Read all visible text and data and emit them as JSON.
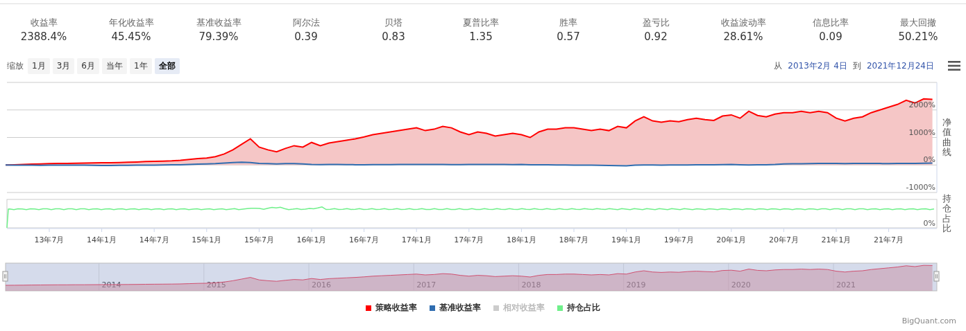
{
  "stats": [
    {
      "label": "收益率",
      "value": "2388.4%"
    },
    {
      "label": "年化收益率",
      "value": "45.45%"
    },
    {
      "label": "基准收益率",
      "value": "79.39%"
    },
    {
      "label": "阿尔法",
      "value": "0.39"
    },
    {
      "label": "贝塔",
      "value": "0.83"
    },
    {
      "label": "夏普比率",
      "value": "1.35"
    },
    {
      "label": "胜率",
      "value": "0.57"
    },
    {
      "label": "盈亏比",
      "value": "0.92"
    },
    {
      "label": "收益波动率",
      "value": "28.61%"
    },
    {
      "label": "信息比率",
      "value": "0.09"
    },
    {
      "label": "最大回撤",
      "value": "50.21%"
    }
  ],
  "zoom": {
    "label": "缩放",
    "buttons": [
      {
        "label": "1月",
        "selected": false
      },
      {
        "label": "3月",
        "selected": false
      },
      {
        "label": "6月",
        "selected": false
      },
      {
        "label": "当年",
        "selected": false
      },
      {
        "label": "1年",
        "selected": false
      },
      {
        "label": "全部",
        "selected": true
      }
    ]
  },
  "range": {
    "from_label": "从",
    "from": "2013年2月 4日",
    "to_label": "到",
    "to": "2021年12月24日"
  },
  "chart": {
    "axis_titles": [
      "净值曲线",
      "持仓占比"
    ],
    "lower_axis_tick": "0%",
    "chart_data": {
      "type": "line",
      "grid": true,
      "categories": [
        null,
        null,
        null,
        null,
        null,
        "13年7月",
        null,
        null,
        null,
        null,
        null,
        "14年1月",
        null,
        null,
        null,
        null,
        null,
        "14年7月",
        null,
        null,
        null,
        null,
        null,
        "15年1月",
        null,
        null,
        null,
        null,
        null,
        "15年7月",
        null,
        null,
        null,
        null,
        null,
        "16年1月",
        null,
        null,
        null,
        null,
        null,
        "16年7月",
        null,
        null,
        null,
        null,
        null,
        "17年1月",
        null,
        null,
        null,
        null,
        null,
        "17年7月",
        null,
        null,
        null,
        null,
        null,
        "18年1月",
        null,
        null,
        null,
        null,
        null,
        "18年7月",
        null,
        null,
        null,
        null,
        null,
        "19年1月",
        null,
        null,
        null,
        null,
        null,
        "19年7月",
        null,
        null,
        null,
        null,
        null,
        "20年1月",
        null,
        null,
        null,
        null,
        null,
        "20年7月",
        null,
        null,
        null,
        null,
        null,
        "21年1月",
        null,
        null,
        null,
        null,
        null,
        "21年7月",
        null,
        null,
        null,
        null,
        null
      ],
      "series": [
        {
          "name": "策略收益率",
          "type": "area",
          "color": "#ff0000",
          "values": [
            0,
            10,
            20,
            30,
            40,
            50,
            55,
            60,
            65,
            70,
            75,
            80,
            85,
            90,
            100,
            110,
            125,
            130,
            140,
            150,
            170,
            200,
            230,
            250,
            300,
            400,
            550,
            750,
            950,
            650,
            550,
            480,
            600,
            700,
            650,
            820,
            700,
            800,
            850,
            900,
            950,
            1020,
            1100,
            1150,
            1200,
            1250,
            1300,
            1350,
            1250,
            1300,
            1400,
            1350,
            1200,
            1100,
            1200,
            1150,
            1050,
            1100,
            1150,
            1100,
            1000,
            1200,
            1300,
            1300,
            1350,
            1350,
            1300,
            1250,
            1300,
            1250,
            1400,
            1350,
            1600,
            1750,
            1600,
            1550,
            1600,
            1570,
            1650,
            1700,
            1650,
            1620,
            1780,
            1820,
            1700,
            1950,
            1800,
            1750,
            1850,
            1900,
            1900,
            1950,
            1900,
            1950,
            1900,
            1700,
            1600,
            1700,
            1750,
            1900,
            2000,
            2100,
            2200,
            2350,
            2250,
            2400,
            2380
          ]
        },
        {
          "name": "基准收益率",
          "color": "#2f6db0",
          "values": [
            0,
            -5,
            -10,
            -10,
            -15,
            -10,
            -10,
            -5,
            -10,
            -10,
            -15,
            -20,
            -20,
            -15,
            -15,
            -10,
            -10,
            -5,
            0,
            5,
            10,
            20,
            30,
            40,
            50,
            70,
            90,
            100,
            90,
            60,
            50,
            40,
            50,
            50,
            40,
            20,
            15,
            20,
            20,
            15,
            10,
            10,
            15,
            15,
            15,
            20,
            20,
            20,
            20,
            20,
            20,
            15,
            15,
            20,
            20,
            20,
            20,
            20,
            15,
            20,
            10,
            5,
            5,
            0,
            0,
            -5,
            -10,
            -10,
            -15,
            -20,
            -25,
            -30,
            -10,
            0,
            0,
            -5,
            0,
            0,
            0,
            5,
            5,
            10,
            15,
            20,
            10,
            0,
            5,
            10,
            20,
            40,
            45,
            45,
            50,
            55,
            60,
            60,
            50,
            55,
            55,
            60,
            55,
            50,
            55,
            60,
            60,
            65,
            70
          ]
        }
      ],
      "ylim": [
        -1000,
        3000
      ],
      "yticks": [
        {
          "value": 2000,
          "label": "2000%"
        },
        {
          "value": 1000,
          "label": "1000%"
        },
        {
          "value": 0,
          "label": "0%"
        },
        {
          "value": -1000,
          "label": "-1000%"
        }
      ]
    }
  },
  "navigator": {
    "year_labels": [
      "2014",
      "2015",
      "2016",
      "2017",
      "2018",
      "2019",
      "2020",
      "2021"
    ]
  },
  "legend": [
    {
      "kind": "series",
      "visible": true
    },
    {
      "kind": "series",
      "visible": true
    },
    {
      "kind": "other",
      "label": "相对收益率",
      "color": "#cccccc",
      "visible": false
    },
    {
      "kind": "other",
      "label": "持仓占比",
      "color": "#6ff08a",
      "visible": true
    }
  ],
  "credits": "BigQuant.com"
}
